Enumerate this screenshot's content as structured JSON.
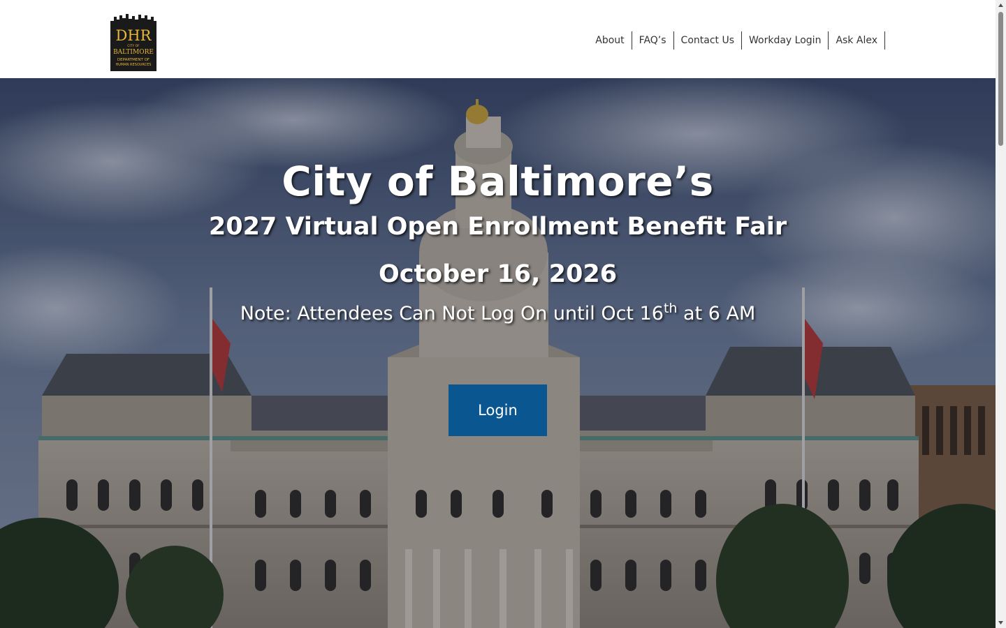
{
  "header": {
    "logo": {
      "main": "DHR",
      "line1": "CITY OF",
      "line2": "BALTIMORE",
      "line3": "DEPARTMENT OF",
      "line4": "HUMAN RESOURCES"
    },
    "nav": [
      "About",
      "FAQ’s",
      "Contact Us",
      "Workday Login",
      "Ask Alex"
    ]
  },
  "hero": {
    "title": "City of Baltimore’s",
    "subtitle": "2027 Virtual Open Enrollment Benefit Fair",
    "date": "October 16, 2026",
    "note_prefix": "Note: Attendees Can Not Log On until Oct 16",
    "note_sup": "th",
    "note_suffix": " at 6 AM",
    "login_label": "Login"
  },
  "colors": {
    "login_button": "#0a5690",
    "logo_background": "#1a1a1a",
    "logo_gold": "#e8b73a",
    "nav_text": "#333333"
  }
}
